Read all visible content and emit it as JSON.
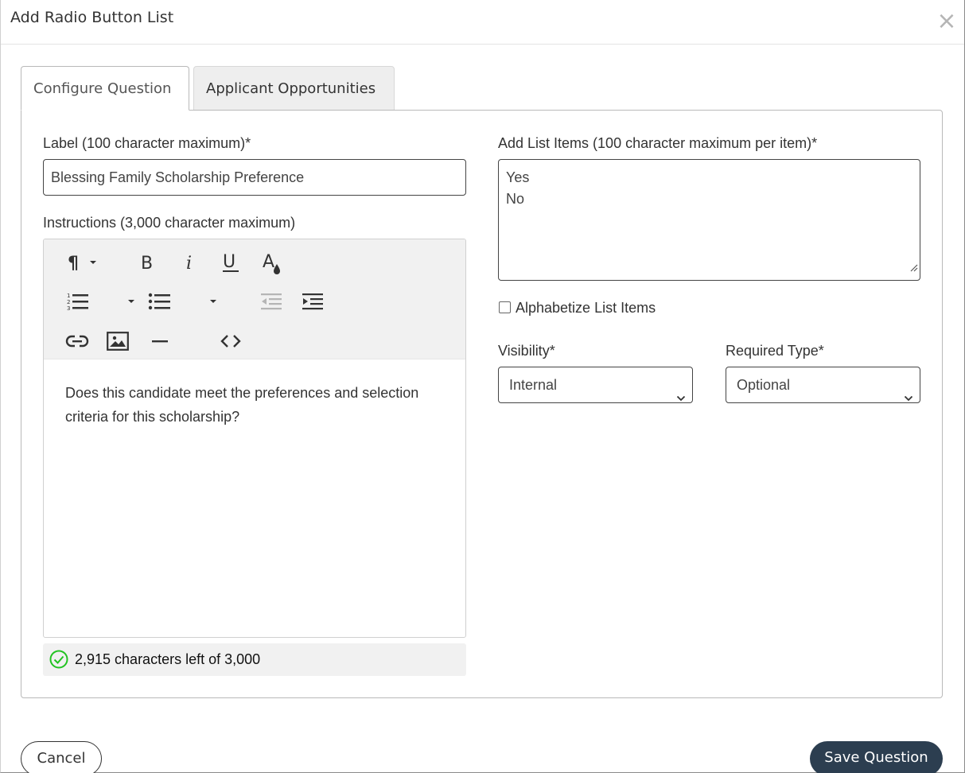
{
  "modal": {
    "title": "Add Radio Button List",
    "close_glyph": "×"
  },
  "tabs": [
    {
      "label": "Configure Question",
      "active": true
    },
    {
      "label": "Applicant Opportunities",
      "active": false
    }
  ],
  "label_field": {
    "label": "Label (100 character maximum)*",
    "value": "Blessing Family Scholarship Preference"
  },
  "instructions": {
    "label": "Instructions (3,000 character maximum)",
    "toolbar_icons": [
      "paragraph-icon",
      "bold-icon",
      "italic-icon",
      "underline-icon",
      "text-color-icon",
      "ordered-list-icon",
      "unordered-list-icon",
      "outdent-icon",
      "indent-icon",
      "link-icon",
      "image-icon",
      "horizontal-rule-icon",
      "code-view-icon"
    ],
    "body": "Does this candidate meet the preferences and selection criteria for this scholarship?",
    "counter": "2,915 characters left of 3,000",
    "counter_icon": "check-circle-icon",
    "counter_color": "#22c322"
  },
  "list_items": {
    "label": "Add List Items (100 character maximum per item)*",
    "items": [
      "Yes",
      "No"
    ]
  },
  "alphabetize": {
    "label": "Alphabetize List Items",
    "checked": false
  },
  "visibility": {
    "label": "Visibility*",
    "value": "Internal"
  },
  "required_type": {
    "label": "Required Type*",
    "value": "Optional"
  },
  "footer": {
    "cancel_label": "Cancel",
    "save_label": "Save Question",
    "save_color": "#2c3e50"
  }
}
